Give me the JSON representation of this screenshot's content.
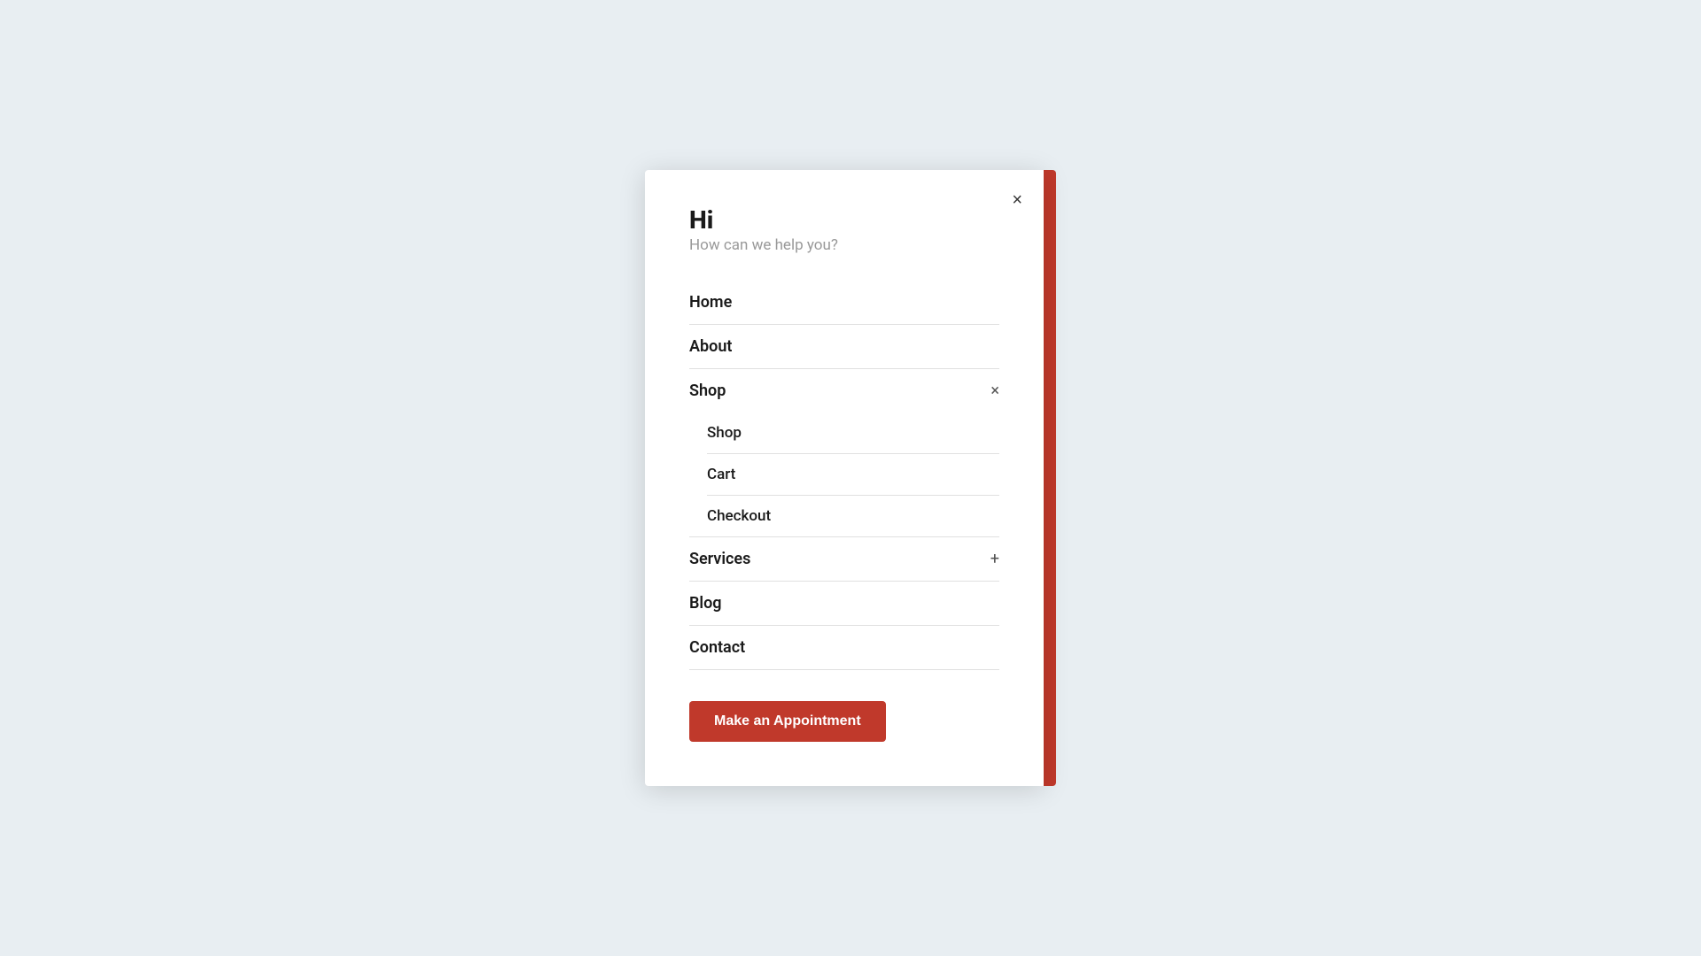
{
  "modal": {
    "greeting": {
      "hi": "Hi",
      "subtitle": "How can we help you?"
    },
    "close_label": "×",
    "nav_items": [
      {
        "id": "home",
        "label": "Home",
        "has_submenu": false,
        "expanded": false
      },
      {
        "id": "about",
        "label": "About",
        "has_submenu": false,
        "expanded": false
      },
      {
        "id": "shop",
        "label": "Shop",
        "has_submenu": true,
        "expanded": true,
        "toggle_icon": "×"
      },
      {
        "id": "services",
        "label": "Services",
        "has_submenu": true,
        "expanded": false,
        "toggle_icon": "+"
      },
      {
        "id": "blog",
        "label": "Blog",
        "has_submenu": false,
        "expanded": false
      },
      {
        "id": "contact",
        "label": "Contact",
        "has_submenu": false,
        "expanded": false
      }
    ],
    "shop_submenu": [
      {
        "id": "shop-sub",
        "label": "Shop"
      },
      {
        "id": "cart",
        "label": "Cart"
      },
      {
        "id": "checkout",
        "label": "Checkout"
      }
    ],
    "appointment_button": "Make an Appointment"
  }
}
